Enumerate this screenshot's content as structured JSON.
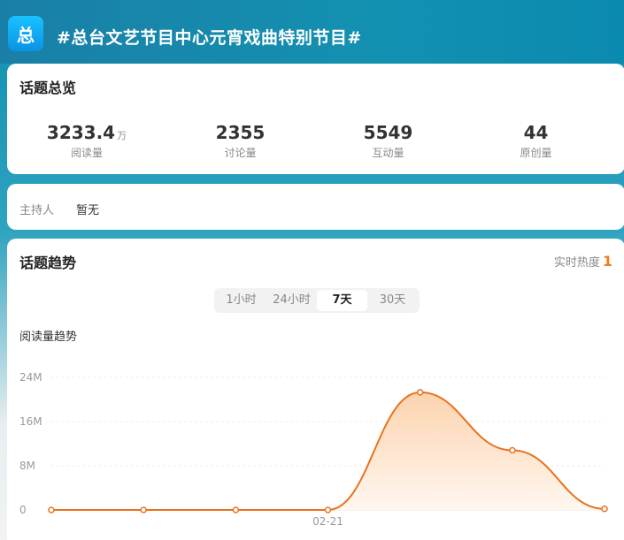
{
  "header": {
    "logo_char": "总",
    "title": "#总台文艺节目中心元宵戏曲特别节目#"
  },
  "overview": {
    "title": "话题总览",
    "stats": [
      {
        "value": "3233.4",
        "unit": "万",
        "label": "阅读量"
      },
      {
        "value": "2355",
        "unit": "",
        "label": "讨论量"
      },
      {
        "value": "5549",
        "unit": "",
        "label": "互动量"
      },
      {
        "value": "44",
        "unit": "",
        "label": "原创量"
      }
    ]
  },
  "host": {
    "label": "主持人",
    "value": "暂无"
  },
  "trend": {
    "title": "话题趋势",
    "heat_label": "实时热度",
    "heat_value": "1",
    "tabs": [
      "1小时",
      "24小时",
      "7天",
      "30天"
    ],
    "active_tab": "7天",
    "chart_label": "阅读量趋势"
  },
  "chart_data": {
    "type": "area",
    "title": "",
    "xlabel": "",
    "ylabel": "",
    "ylim": [
      0,
      24000000
    ],
    "ytick_labels": [
      "0",
      "8M",
      "16M",
      "24M"
    ],
    "ytick_values": [
      0,
      8000000,
      16000000,
      24000000
    ],
    "x": [
      "",
      "",
      "",
      "02-21",
      "",
      "",
      ""
    ],
    "values": [
      0,
      0,
      0,
      0,
      21300000,
      10800000,
      200000
    ],
    "grid": true,
    "colors": {
      "line": "#e8731e",
      "fill_top": "#fcd3ae",
      "fill_bottom": "#fff7f0"
    }
  }
}
